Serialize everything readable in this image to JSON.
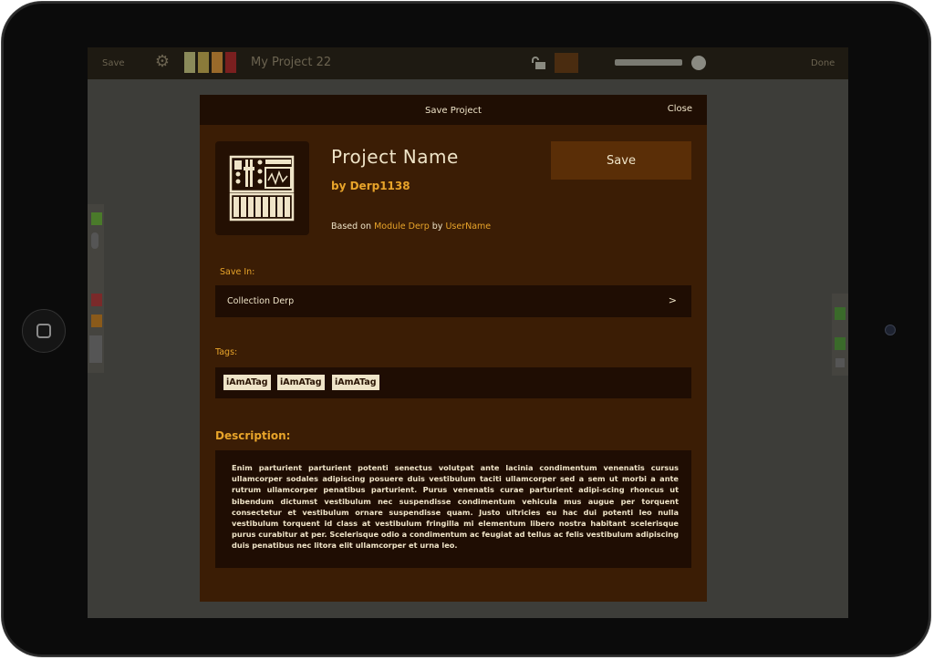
{
  "app": {
    "toolbar": {
      "save_label": "Save",
      "project_title": "My Project 22",
      "done_label": "Done",
      "swatches": [
        "#8a8a5a",
        "#8a7a3a",
        "#9a6a2a",
        "#7a1f1f"
      ],
      "icons": [
        "gear-icon",
        "lock-icon"
      ]
    }
  },
  "modal": {
    "title": "Save Project",
    "close_label": "Close",
    "project_name": "Project Name",
    "by_line": "by Derp1138",
    "based_on_prefix": "Based on",
    "based_on_project": "Module Derp",
    "based_on_by": "by",
    "based_on_user": "UserName",
    "save_label": "Save",
    "icon": "synth-module-icon",
    "save_in_label": "Save In:",
    "collection": "Collection Derp",
    "collection_chevron": ">",
    "tags_label": "Tags:",
    "tags": [
      "iAmATag",
      "iAmATag",
      "iAmATag"
    ],
    "description_label": "Description:",
    "description": "Enim parturient parturient potenti senectus volutpat ante lacinia condimentum venenatis cursus ullamcorper sodales adipiscing posuere duis vestibulum taciti ullamcorper sed a sem ut morbi a ante rutrum ullamcorper penatibus parturient. Purus venenatis curae parturient adipi-scing rhoncus ut bibendum dictumst vestibulum nec suspendisse condimentum vehicula mus augue per torquent consectetur et vestibulum ornare suspendisse quam. Justo ultricies eu hac dui potenti leo nulla vestibulum torquent id class at vestibulum fringilla mi elementum libero nostra habitant scelerisque purus curabitur at per. Scelerisque odio a condimentum ac feugiat ad tellus ac felis vestibulum adipiscing duis penatibus nec litora elit ullamcorper et urna leo."
  },
  "colors": {
    "accent": "#e8a42a",
    "modal_bg": "#3b1d05",
    "panel_bg": "#1f0d03",
    "text": "#efe4c8"
  }
}
